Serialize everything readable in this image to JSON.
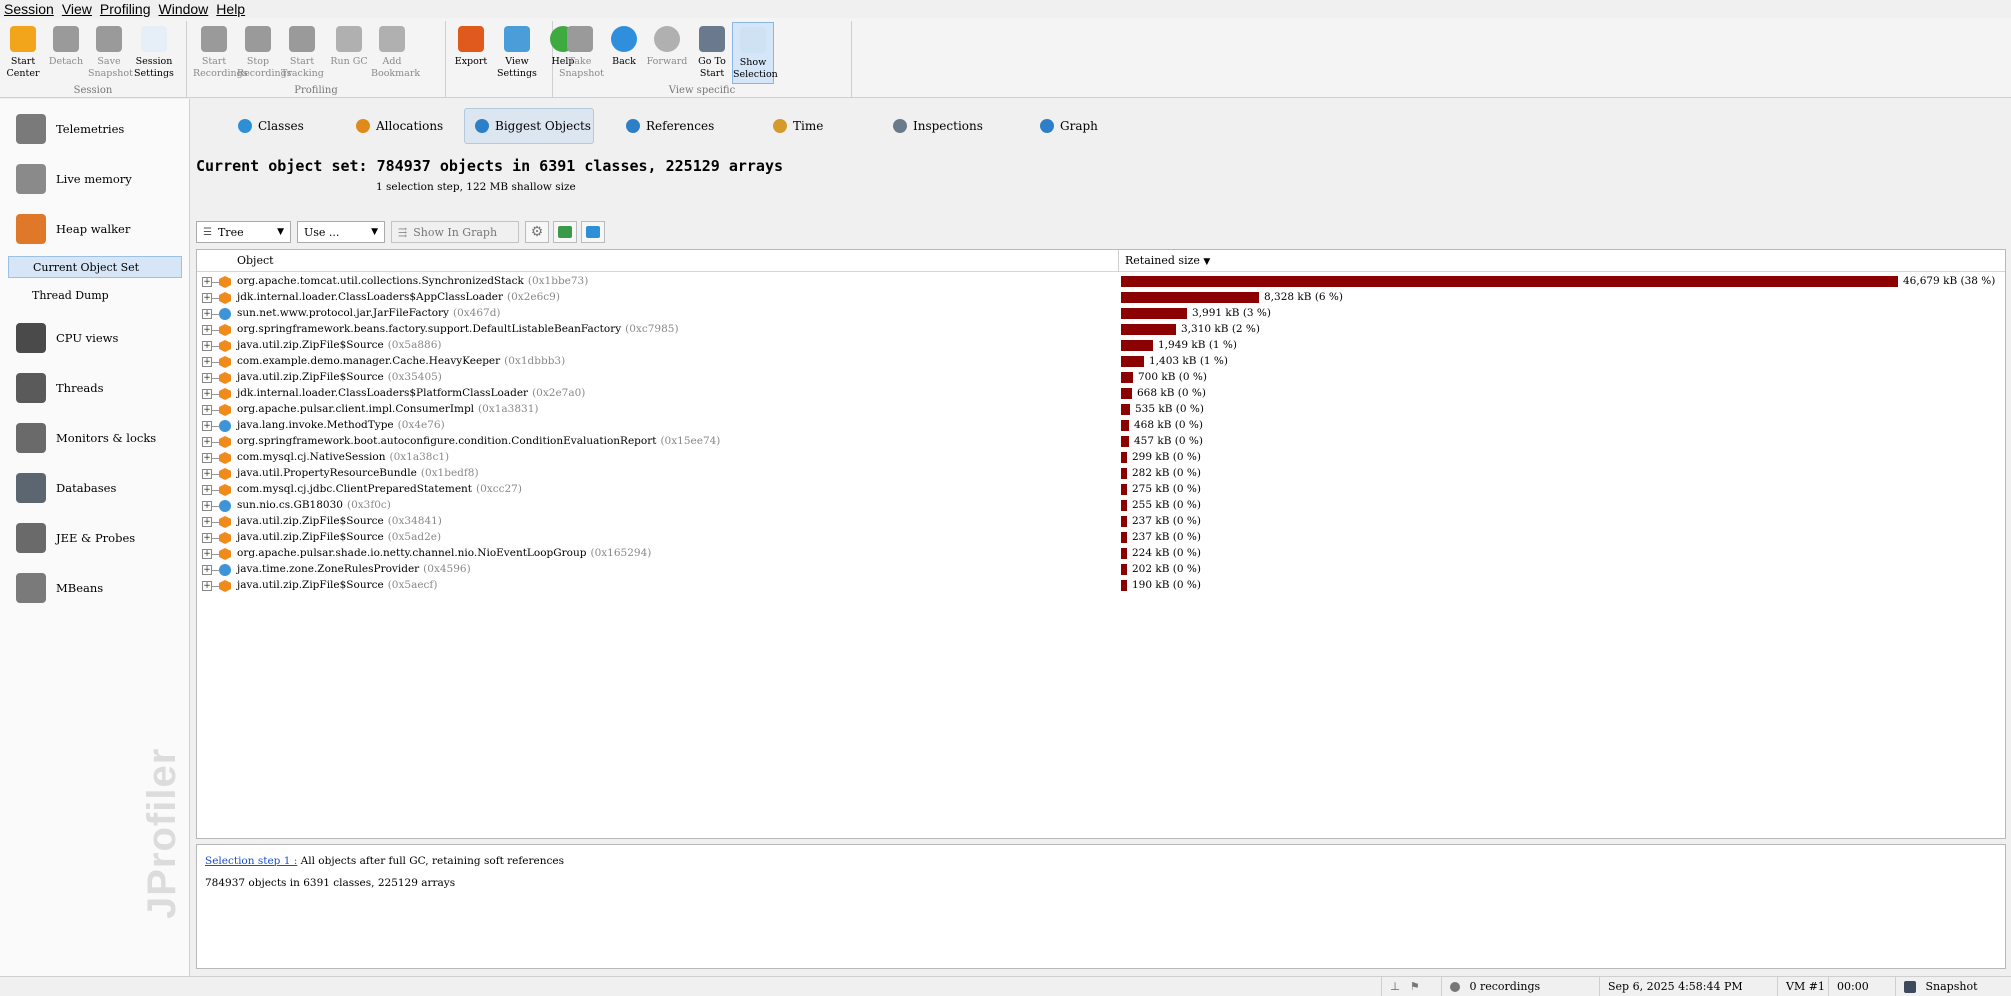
{
  "menu": [
    "Session",
    "View",
    "Profiling",
    "Window",
    "Help"
  ],
  "toolbar": {
    "groups": [
      {
        "label": "Session",
        "buttons": [
          {
            "label": "Start Center",
            "icon": "start-center-icon",
            "state": "normal"
          },
          {
            "label": "Detach",
            "icon": "detach-icon",
            "state": "disabled"
          },
          {
            "label": "Save Snapshot",
            "icon": "save-snapshot-icon",
            "state": "disabled"
          },
          {
            "label": "Session Settings",
            "icon": "session-settings-icon",
            "state": "normal"
          }
        ]
      },
      {
        "label": "Profiling",
        "buttons": [
          {
            "label": "Start Recordings",
            "icon": "start-recordings-icon",
            "state": "disabled"
          },
          {
            "label": "Stop Recordings",
            "icon": "stop-recordings-icon",
            "state": "disabled"
          },
          {
            "label": "Start Tracking",
            "icon": "start-tracking-icon",
            "state": "disabled"
          },
          {
            "label": "Run GC",
            "icon": "run-gc-icon",
            "state": "disabled"
          },
          {
            "label": "Add Bookmark",
            "icon": "add-bookmark-icon",
            "state": "disabled"
          }
        ]
      },
      {
        "label": "",
        "buttons": [
          {
            "label": "Export",
            "icon": "export-icon",
            "state": "normal"
          },
          {
            "label": "View Settings",
            "icon": "view-settings-icon",
            "state": "normal"
          },
          {
            "label": "Help",
            "icon": "help-icon",
            "state": "normal"
          }
        ]
      },
      {
        "label": "View specific",
        "buttons": [
          {
            "label": "Take Snapshot",
            "icon": "take-snapshot-icon",
            "state": "disabled"
          },
          {
            "label": "Back",
            "icon": "back-icon",
            "state": "normal"
          },
          {
            "label": "Forward",
            "icon": "forward-icon",
            "state": "disabled"
          },
          {
            "label": "Go To Start",
            "icon": "go-to-start-icon",
            "state": "normal"
          },
          {
            "label": "Show Selection",
            "icon": "show-selection-icon",
            "state": "selected"
          }
        ]
      }
    ]
  },
  "sidebar": {
    "items": [
      {
        "label": "Telemetries",
        "icon": "telemetries-icon"
      },
      {
        "label": "Live memory",
        "icon": "live-memory-icon"
      },
      {
        "label": "Heap walker",
        "icon": "heap-walker-icon"
      },
      {
        "label": "CPU views",
        "icon": "cpu-views-icon"
      },
      {
        "label": "Threads",
        "icon": "threads-icon"
      },
      {
        "label": "Monitors & locks",
        "icon": "monitors-locks-icon"
      },
      {
        "label": "Databases",
        "icon": "databases-icon"
      },
      {
        "label": "JEE & Probes",
        "icon": "jee-probes-icon"
      },
      {
        "label": "MBeans",
        "icon": "mbeans-icon"
      }
    ],
    "subitems": [
      {
        "label": "Current Object Set",
        "selected": true
      },
      {
        "label": "Thread Dump",
        "selected": false
      }
    ],
    "watermark": "JProfiler"
  },
  "tabs": [
    {
      "label": "Classes",
      "icon": "classes-icon",
      "selected": false
    },
    {
      "label": "Allocations",
      "icon": "allocations-icon",
      "selected": false
    },
    {
      "label": "Biggest Objects",
      "icon": "biggest-objects-icon",
      "selected": true
    },
    {
      "label": "References",
      "icon": "references-icon",
      "selected": false
    },
    {
      "label": "Time",
      "icon": "time-icon",
      "selected": false
    },
    {
      "label": "Inspections",
      "icon": "inspections-icon",
      "selected": false
    },
    {
      "label": "Graph",
      "icon": "graph-icon",
      "selected": false
    }
  ],
  "heading": "Current object set: 784937 objects in 6391 classes, 225129 arrays",
  "subheading": "1 selection step, 122 MB shallow size",
  "view_tools": {
    "tree_label": "Tree",
    "use_label": "Use ...",
    "show_in_graph_label": "Show In Graph"
  },
  "table": {
    "col_object": "Object",
    "col_retained": "Retained size",
    "rows": [
      {
        "name": "org.apache.tomcat.util.collections.SynchronizedStack",
        "addr": "(0x1bbe73)",
        "type": "jar",
        "value": "46,679 kB (38 %)",
        "fraction": 1.0
      },
      {
        "name": "jdk.internal.loader.ClassLoaders$AppClassLoader",
        "addr": "(0x2e6c9)",
        "type": "jar",
        "value": "8,328 kB (6 %)",
        "fraction": 0.178
      },
      {
        "name": "sun.net.www.protocol.jar.JarFileFactory",
        "addr": "(0x467d)",
        "type": "cls",
        "value": "3,991 kB (3 %)",
        "fraction": 0.0855
      },
      {
        "name": "org.springframework.beans.factory.support.DefaultListableBeanFactory",
        "addr": "(0xc7985)",
        "type": "jar",
        "value": "3,310 kB (2 %)",
        "fraction": 0.0709
      },
      {
        "name": "java.util.zip.ZipFile$Source",
        "addr": "(0x5a886)",
        "type": "jar",
        "value": "1,949 kB (1 %)",
        "fraction": 0.0418
      },
      {
        "name": "com.example.demo.manager.Cache.HeavyKeeper",
        "addr": "(0x1dbbb3)",
        "type": "jar",
        "value": "1,403 kB (1 %)",
        "fraction": 0.0301
      },
      {
        "name": "java.util.zip.ZipFile$Source",
        "addr": "(0x35405)",
        "type": "jar",
        "value": "700 kB (0 %)",
        "fraction": 0.015
      },
      {
        "name": "jdk.internal.loader.ClassLoaders$PlatformClassLoader",
        "addr": "(0x2e7a0)",
        "type": "jar",
        "value": "668 kB (0 %)",
        "fraction": 0.0143
      },
      {
        "name": "org.apache.pulsar.client.impl.ConsumerImpl",
        "addr": "(0x1a3831)",
        "type": "jar",
        "value": "535 kB (0 %)",
        "fraction": 0.0115
      },
      {
        "name": "java.lang.invoke.MethodType",
        "addr": "(0x4e76)",
        "type": "cls",
        "value": "468 kB (0 %)",
        "fraction": 0.01
      },
      {
        "name": "org.springframework.boot.autoconfigure.condition.ConditionEvaluationReport",
        "addr": "(0x15ee74)",
        "type": "jar",
        "value": "457 kB (0 %)",
        "fraction": 0.0098
      },
      {
        "name": "com.mysql.cj.NativeSession",
        "addr": "(0x1a38c1)",
        "type": "jar",
        "value": "299 kB (0 %)",
        "fraction": 0.0064
      },
      {
        "name": "java.util.PropertyResourceBundle",
        "addr": "(0x1bedf8)",
        "type": "jar",
        "value": "282 kB (0 %)",
        "fraction": 0.006
      },
      {
        "name": "com.mysql.cj.jdbc.ClientPreparedStatement",
        "addr": "(0xcc27)",
        "type": "jar",
        "value": "275 kB (0 %)",
        "fraction": 0.0059
      },
      {
        "name": "sun.nio.cs.GB18030",
        "addr": "(0x3f0c)",
        "type": "cls",
        "value": "255 kB (0 %)",
        "fraction": 0.0055
      },
      {
        "name": "java.util.zip.ZipFile$Source",
        "addr": "(0x34841)",
        "type": "jar",
        "value": "237 kB (0 %)",
        "fraction": 0.0051
      },
      {
        "name": "java.util.zip.ZipFile$Source",
        "addr": "(0x5ad2e)",
        "type": "jar",
        "value": "237 kB (0 %)",
        "fraction": 0.0051
      },
      {
        "name": "org.apache.pulsar.shade.io.netty.channel.nio.NioEventLoopGroup",
        "addr": "(0x165294)",
        "type": "jar",
        "value": "224 kB (0 %)",
        "fraction": 0.0048
      },
      {
        "name": "java.time.zone.ZoneRulesProvider",
        "addr": "(0x4596)",
        "type": "cls",
        "value": "202 kB (0 %)",
        "fraction": 0.0043
      },
      {
        "name": "java.util.zip.ZipFile$Source",
        "addr": "(0x5aecf)",
        "type": "jar",
        "value": "190 kB (0 %)",
        "fraction": 0.0041
      }
    ]
  },
  "detail": {
    "step_link": "Selection step 1 :",
    "step_text": "All objects after full GC, retaining soft references",
    "summary": "784937 objects in 6391 classes, 225129 arrays"
  },
  "statusbar": {
    "recordings": "0 recordings",
    "datetime": "Sep 6, 2025 4:58:44 PM",
    "vm": "VM #1",
    "elapsed": "00:00",
    "mode": "Snapshot"
  },
  "colors": {
    "bar": "#8b0000",
    "link": "#1a4fd0",
    "selection": "#d6e6f6"
  }
}
